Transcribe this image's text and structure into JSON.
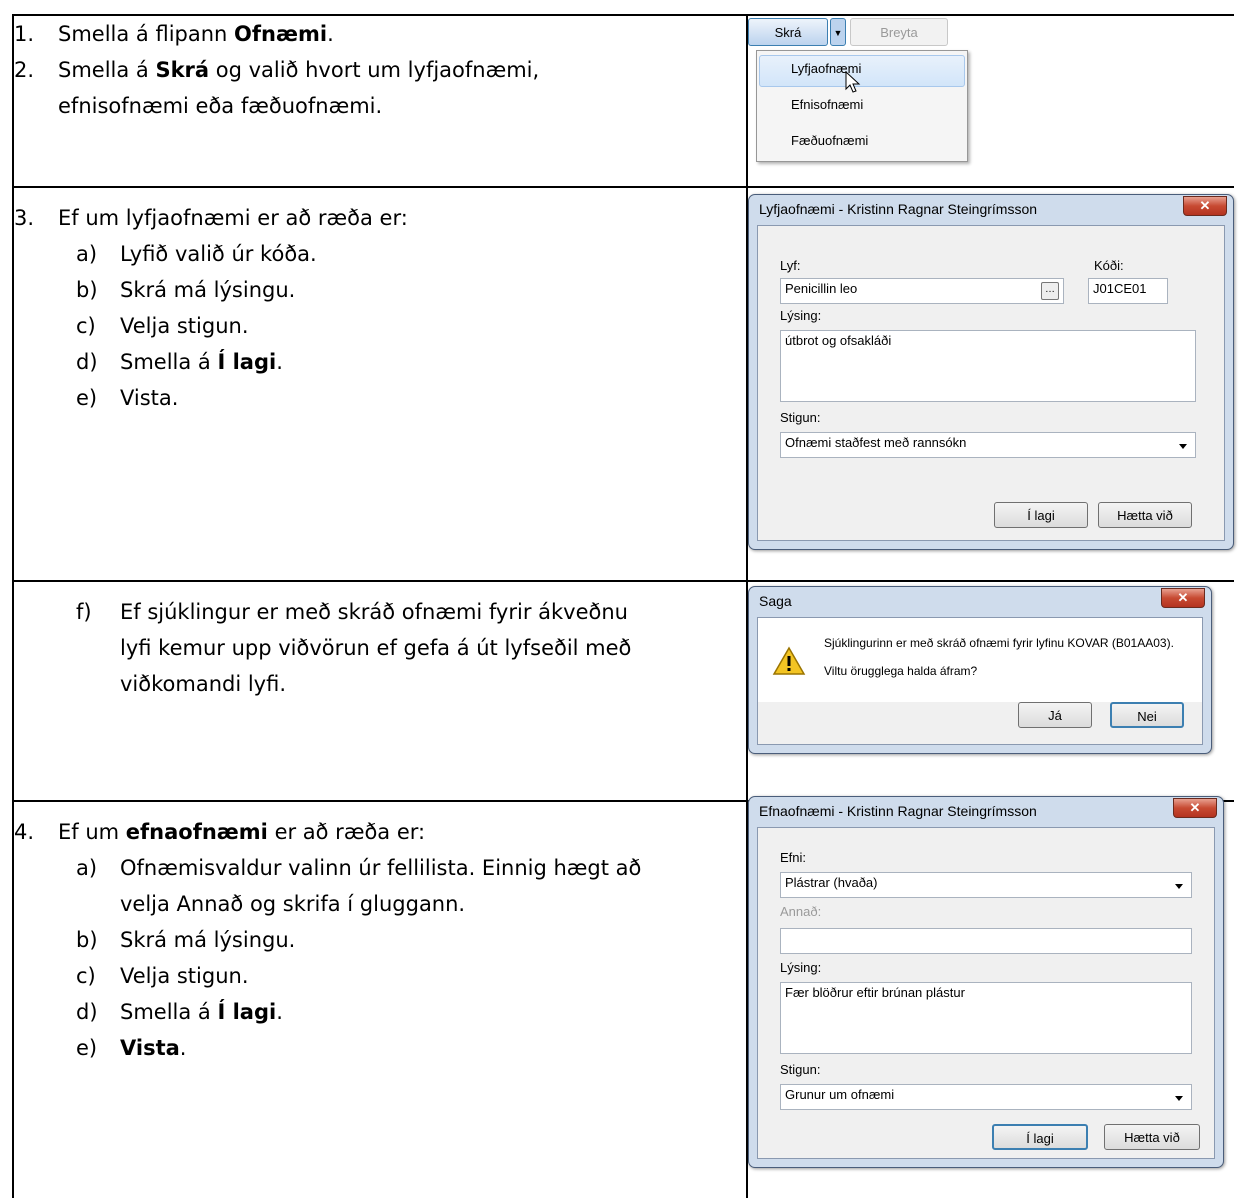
{
  "rows": [
    {
      "steps": [
        {
          "num": "1.",
          "pre": "Smella á flipann ",
          "bold": "Ofnæmi",
          "post": "."
        },
        {
          "num": "2.",
          "pre": "Smella á ",
          "bold": "Skrá",
          "post": " og valið hvort um lyfjaofnæmi,",
          "line2": "efnisofnæmi eða fæðuofnæmi."
        }
      ]
    },
    {
      "num": "3.",
      "intro": "Ef um lyfjaofnæmi er að ræða er:",
      "subs": [
        {
          "let": "a)",
          "pre": "Lyfið valið úr kóða.",
          "bold": "",
          "post": ""
        },
        {
          "let": "b)",
          "pre": "Skrá má lýsingu.",
          "bold": "",
          "post": ""
        },
        {
          "let": "c)",
          "pre": "Velja stigun.",
          "bold": "",
          "post": ""
        },
        {
          "let": "d)",
          "pre": "Smella á ",
          "bold": "Í lagi",
          "post": "."
        },
        {
          "let": "e)",
          "pre": "Vista.",
          "bold": "",
          "post": ""
        }
      ]
    },
    {
      "let": "f)",
      "l1": "Ef sjúklingur er með skráð ofnæmi fyrir ákveðnu",
      "l2": "lyfi kemur upp viðvörun ef gefa á út lyfseðil með",
      "l3": "viðkomandi lyfi."
    },
    {
      "num": "4.",
      "intro_pre": "Ef um ",
      "intro_bold": "efnaofnæmi",
      "intro_post": " er að ræða er:",
      "a1": "Ofnæmisvaldur valinn úr fellilista. Einnig hægt að",
      "a2": "velja Annað og skrifa í gluggann.",
      "subs": [
        {
          "let": "b)",
          "pre": "Skrá má lýsingu.",
          "bold": "",
          "post": ""
        },
        {
          "let": "c)",
          "pre": "Velja stigun.",
          "bold": "",
          "post": ""
        },
        {
          "let": "d)",
          "pre": "Smella á ",
          "bold": "Í lagi",
          "post": "."
        },
        {
          "let": "e)",
          "pre": "",
          "bold": "Vista",
          "post": "."
        }
      ]
    }
  ],
  "toolbar": {
    "skra": "Skrá",
    "breyta": "Breyta",
    "menu": [
      "Lyfjaofnæmi",
      "Efnisofnæmi",
      "Fæðuofnæmi"
    ]
  },
  "dlg1": {
    "title": "Lyfjaofnæmi - Kristinn Ragnar Steingrímsson",
    "lyf_label": "Lyf:",
    "lyf": "Penicillin leo",
    "kodi_label": "Kóði:",
    "kodi": "J01CE01",
    "lysing_label": "Lýsing:",
    "lysing": "útbrot og ofsakláði",
    "stigun_label": "Stigun:",
    "stigun": "Ofnæmi staðfest með rannsókn",
    "ok": "Í lagi",
    "cancel": "Hætta við"
  },
  "dlg2": {
    "title": "Saga",
    "msg1": "Sjúklingurinn er með skráð ofnæmi fyrir lyfinu KOVAR (B01AA03).",
    "msg2": "Viltu örugglega halda áfram?",
    "yes": "Já",
    "no": "Nei"
  },
  "dlg3": {
    "title": "Efnaofnæmi - Kristinn Ragnar Steingrímsson",
    "efni_label": "Efni:",
    "efni": "Plástrar (hvaða)",
    "annad_label": "Annað:",
    "lysing_label": "Lýsing:",
    "lysing": "Fær blöðrur eftir brúnan plástur",
    "stigun_label": "Stigun:",
    "stigun": "Grunur um ofnæmi",
    "ok": "Í lagi",
    "cancel": "Hætta við"
  }
}
